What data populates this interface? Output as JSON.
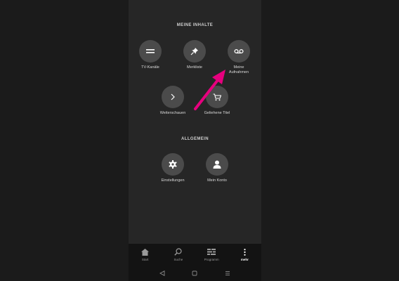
{
  "sections": {
    "content_title": "MEINE INHALTE",
    "general_title": "ALLGEMEIN"
  },
  "tiles": {
    "tv": {
      "label": "TV-Kanäle",
      "icon": "equals-icon"
    },
    "watchlist": {
      "label": "Merkliste",
      "icon": "pin-icon"
    },
    "recordings": {
      "label": "Meine\nAufnahmen",
      "icon": "voicemail-icon"
    },
    "continue": {
      "label": "Weiterschauen",
      "icon": "chevron-right-icon"
    },
    "rented": {
      "label": "Geliehene Titel",
      "icon": "cart-icon"
    },
    "settings": {
      "label": "Einstellungen",
      "icon": "gear-icon"
    },
    "account": {
      "label": "Mein Konto",
      "icon": "person-icon"
    }
  },
  "tabs": [
    {
      "label": "Start",
      "icon": "home-icon"
    },
    {
      "label": "Suche",
      "icon": "search-icon"
    },
    {
      "label": "Programm",
      "icon": "grid-icon"
    },
    {
      "label": "mehr",
      "icon": "more-vertical-icon",
      "active": true
    }
  ],
  "colors": {
    "accent_arrow": "#e6007e",
    "background": "#262626",
    "tile_circle": "#4b4b4b"
  }
}
